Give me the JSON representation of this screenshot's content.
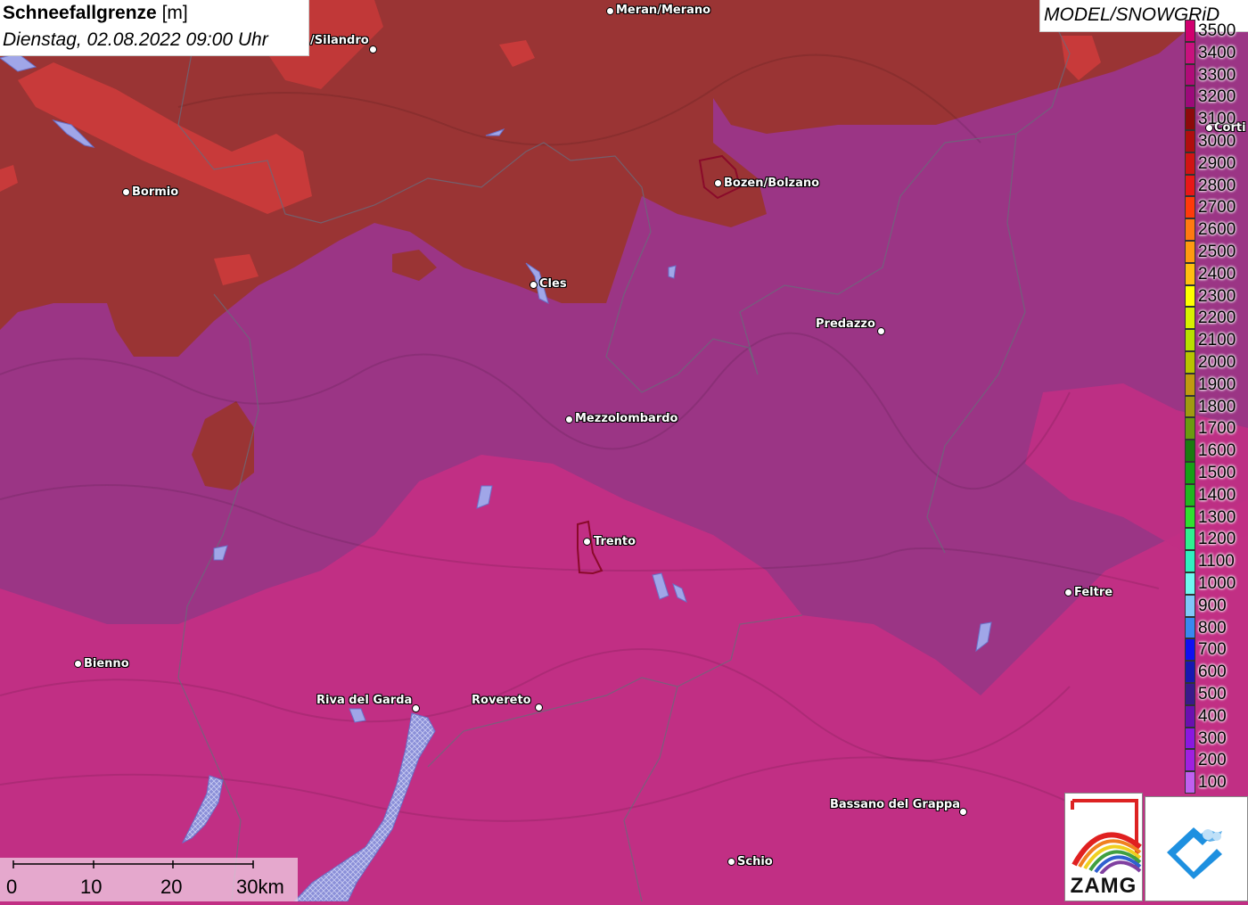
{
  "title": {
    "main": "Schneefallgrenze",
    "unit": "[m]",
    "datetime": "Dienstag, 02.08.2022 09:00 Uhr"
  },
  "model_label": "MODEL/SNOWGRiD",
  "cities": [
    {
      "name": "Meran/Merano"
    },
    {
      "name": "/Silandro"
    },
    {
      "name": "Bormio"
    },
    {
      "name": "Bozen/Bolzano"
    },
    {
      "name": "Cles"
    },
    {
      "name": "Predazzo"
    },
    {
      "name": "Mezzolombardo"
    },
    {
      "name": "Trento"
    },
    {
      "name": "Feltre"
    },
    {
      "name": "Bienno"
    },
    {
      "name": "Riva del Garda"
    },
    {
      "name": "Rovereto"
    },
    {
      "name": "Bassano del Grappa"
    },
    {
      "name": "Schio"
    },
    {
      "name": "Corti"
    }
  ],
  "legend": [
    {
      "value": "3500",
      "color": "#d0006f"
    },
    {
      "value": "3400",
      "color": "#c8127e"
    },
    {
      "value": "3300",
      "color": "#b00c78"
    },
    {
      "value": "3200",
      "color": "#9c0a7a"
    },
    {
      "value": "3100",
      "color": "#8c0a0a"
    },
    {
      "value": "3000",
      "color": "#b00e0e"
    },
    {
      "value": "2900",
      "color": "#d01414"
    },
    {
      "value": "2800",
      "color": "#e81818"
    },
    {
      "value": "2700",
      "color": "#ff3a0a"
    },
    {
      "value": "2600",
      "color": "#ff7a10"
    },
    {
      "value": "2500",
      "color": "#ff9a10"
    },
    {
      "value": "2400",
      "color": "#ffbe10"
    },
    {
      "value": "2300",
      "color": "#ffff00"
    },
    {
      "value": "2200",
      "color": "#d8f000"
    },
    {
      "value": "2100",
      "color": "#b8e000"
    },
    {
      "value": "2000",
      "color": "#b8c400"
    },
    {
      "value": "1900",
      "color": "#c09a10"
    },
    {
      "value": "1800",
      "color": "#a09a10"
    },
    {
      "value": "1700",
      "color": "#6a9a10"
    },
    {
      "value": "1600",
      "color": "#1a7a10"
    },
    {
      "value": "1500",
      "color": "#16a016"
    },
    {
      "value": "1400",
      "color": "#20b820"
    },
    {
      "value": "1300",
      "color": "#30e030"
    },
    {
      "value": "1200",
      "color": "#30f090"
    },
    {
      "value": "1100",
      "color": "#30f0c0"
    },
    {
      "value": "1000",
      "color": "#70f8f0"
    },
    {
      "value": "900",
      "color": "#80c8f8"
    },
    {
      "value": "800",
      "color": "#3888f0"
    },
    {
      "value": "700",
      "color": "#1010f0"
    },
    {
      "value": "600",
      "color": "#1818b0"
    },
    {
      "value": "500",
      "color": "#3a1a8a"
    },
    {
      "value": "400",
      "color": "#6a10b0"
    },
    {
      "value": "300",
      "color": "#8a18e0"
    },
    {
      "value": "200",
      "color": "#a020e0"
    },
    {
      "value": "100",
      "color": "#c060f0"
    }
  ],
  "scalebar": {
    "labels": [
      "0",
      "10",
      "20",
      "30km"
    ]
  },
  "logos": {
    "zamg": "ZAMG"
  },
  "colors": {
    "snowline_high_brown": "#9a3434",
    "snowline_red": "#c83a3a",
    "snowline_purple": "#9b3585",
    "snowline_magenta": "#c12f84",
    "lake_blue": "#a0a6e8"
  }
}
